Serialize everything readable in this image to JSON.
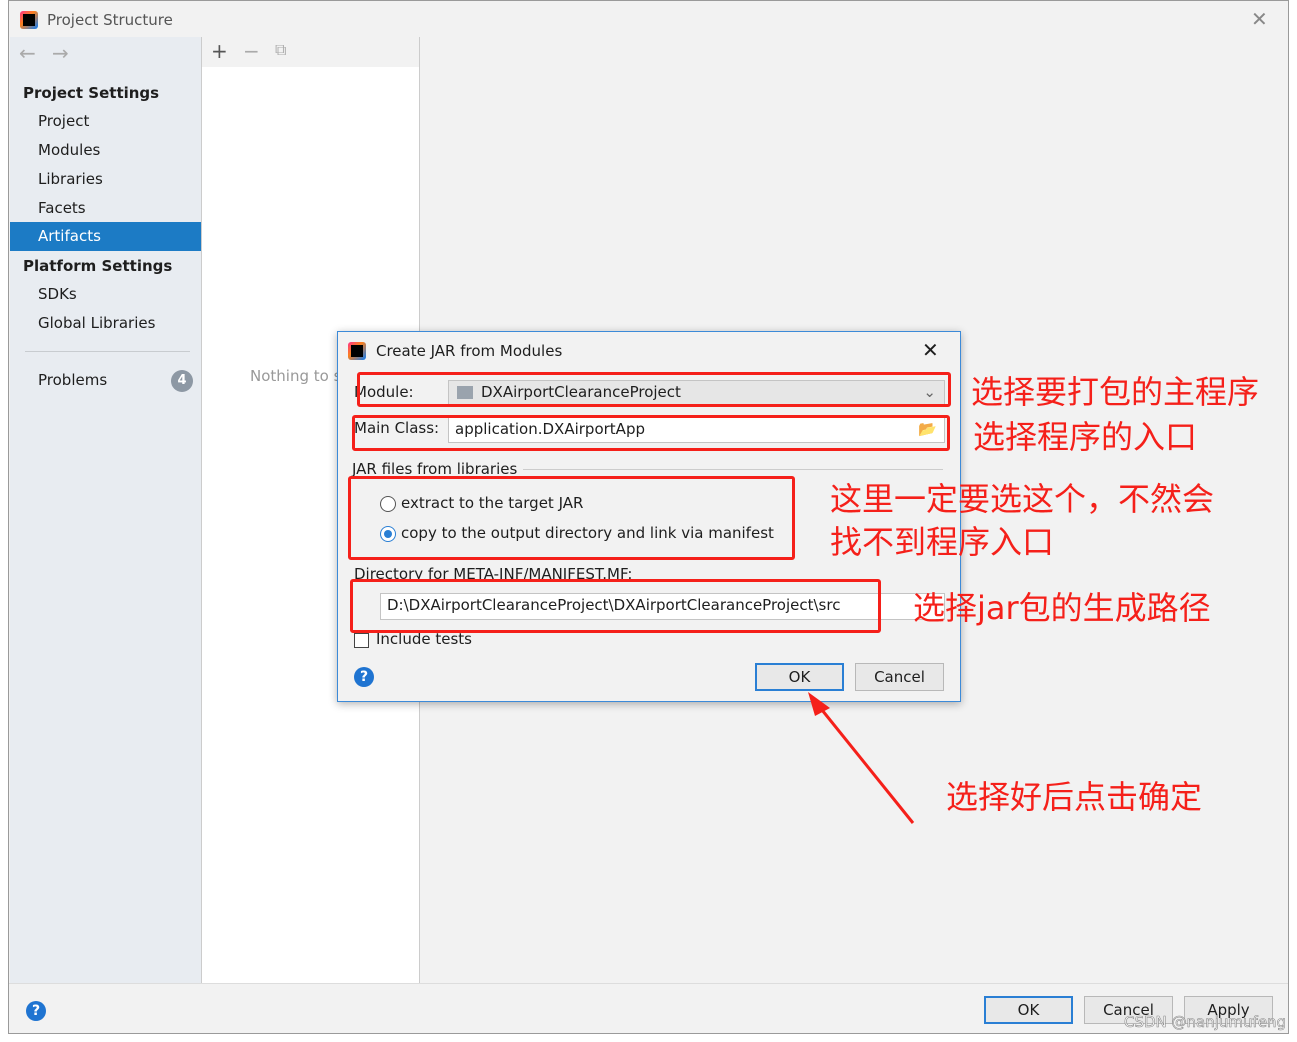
{
  "window": {
    "title": "Project Structure",
    "close_icon": "close-icon"
  },
  "sidebar": {
    "project_settings_heading": "Project Settings",
    "project_items": [
      {
        "label": "Project"
      },
      {
        "label": "Modules"
      },
      {
        "label": "Libraries"
      },
      {
        "label": "Facets"
      },
      {
        "label": "Artifacts",
        "selected": true
      }
    ],
    "platform_settings_heading": "Platform Settings",
    "platform_items": [
      {
        "label": "SDKs"
      },
      {
        "label": "Global Libraries"
      }
    ],
    "problems": {
      "label": "Problems",
      "count": "4"
    }
  },
  "middle": {
    "empty_text": "Nothing to s"
  },
  "footer": {
    "ok": "OK",
    "cancel": "Cancel",
    "apply": "Apply"
  },
  "dialog": {
    "title": "Create JAR from Modules",
    "module_label": "Module:",
    "module_value": "DXAirportClearanceProject",
    "main_class_label": "Main Class:",
    "main_class_value": "application.DXAirportApp",
    "jar_group_label": "JAR files from libraries",
    "option_extract": "extract to the target JAR",
    "option_copy": "copy to the output directory and link via manifest",
    "selected_option": "copy",
    "manifest_dir_label": "Directory for META-INF/MANIFEST.MF:",
    "manifest_dir_value": "D:\\DXAirportClearanceProject\\DXAirportClearanceProject\\src",
    "include_tests_label": "Include tests",
    "include_tests_checked": false,
    "ok": "OK",
    "cancel": "Cancel"
  },
  "annotations": {
    "module": "选择要打包的主程序",
    "main_class": "选择程序的入口",
    "option_line1": "这里一定要选这个，不然会",
    "option_line2": "找不到程序入口",
    "dir": "选择jar包的生成路径",
    "ok": "选择好后点击确定",
    "color": "#f5201a"
  },
  "watermark": "CSDN @nanjumufeng"
}
